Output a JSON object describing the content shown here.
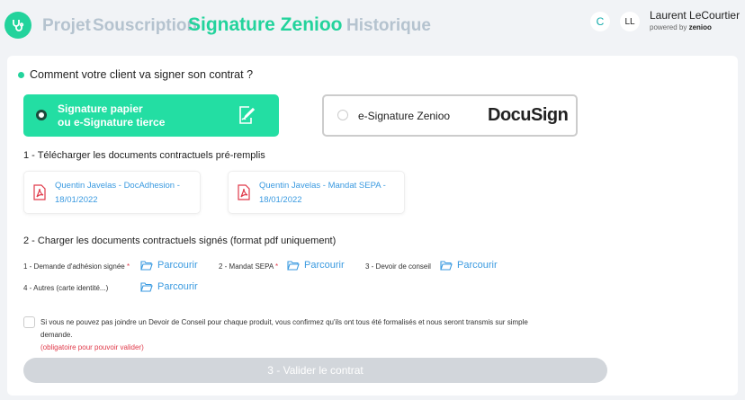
{
  "nav": {
    "items": [
      "Projet",
      "Souscription",
      "Signature Zenioo",
      "Historique"
    ],
    "active": "Signature Zenioo"
  },
  "user": {
    "avatar1": "C",
    "avatar2": "LL",
    "name": "Laurent LeCourtier",
    "powered": "powered by",
    "brand": "zenioo"
  },
  "question": "Comment votre client va signer son contrat ?",
  "options": {
    "paper_line1": "Signature papier",
    "paper_line2": "ou e-Signature tierce",
    "esign": "e-Signature Zenioo",
    "docusign": "DocuSign"
  },
  "section1": {
    "title": "1 - Télécharger les documents contractuels pré-remplis",
    "docs": [
      {
        "line1": "Quentin Javelas - DocAdhesion -",
        "line2": "18/01/2022"
      },
      {
        "line1": "Quentin Javelas - Mandat SEPA -",
        "line2": "18/01/2022"
      }
    ]
  },
  "section2": {
    "title": "2 - Charger les documents contractuels signés (format pdf uniquement)",
    "fields": [
      {
        "label": "1 - Demande d'adhésion signée",
        "req": "*"
      },
      {
        "label": "2 - Mandat SEPA",
        "req": "*"
      },
      {
        "label": "3 - Devoir de conseil"
      },
      {
        "label": "4 - Autres (carte identité...)"
      }
    ],
    "browse": "Parcourir"
  },
  "confirm": {
    "text": "Si vous ne pouvez pas joindre un Devoir de Conseil pour chaque produit, vous confirmez qu'ils ont tous été formalisés et nous seront transmis sur simple demande.",
    "required": "(obligatoire pour pouvoir valider)"
  },
  "submit": "3 - Valider le contrat",
  "colors": {
    "accent": "#23d39c",
    "link": "#3a9ae0",
    "error": "#e03a4a"
  }
}
